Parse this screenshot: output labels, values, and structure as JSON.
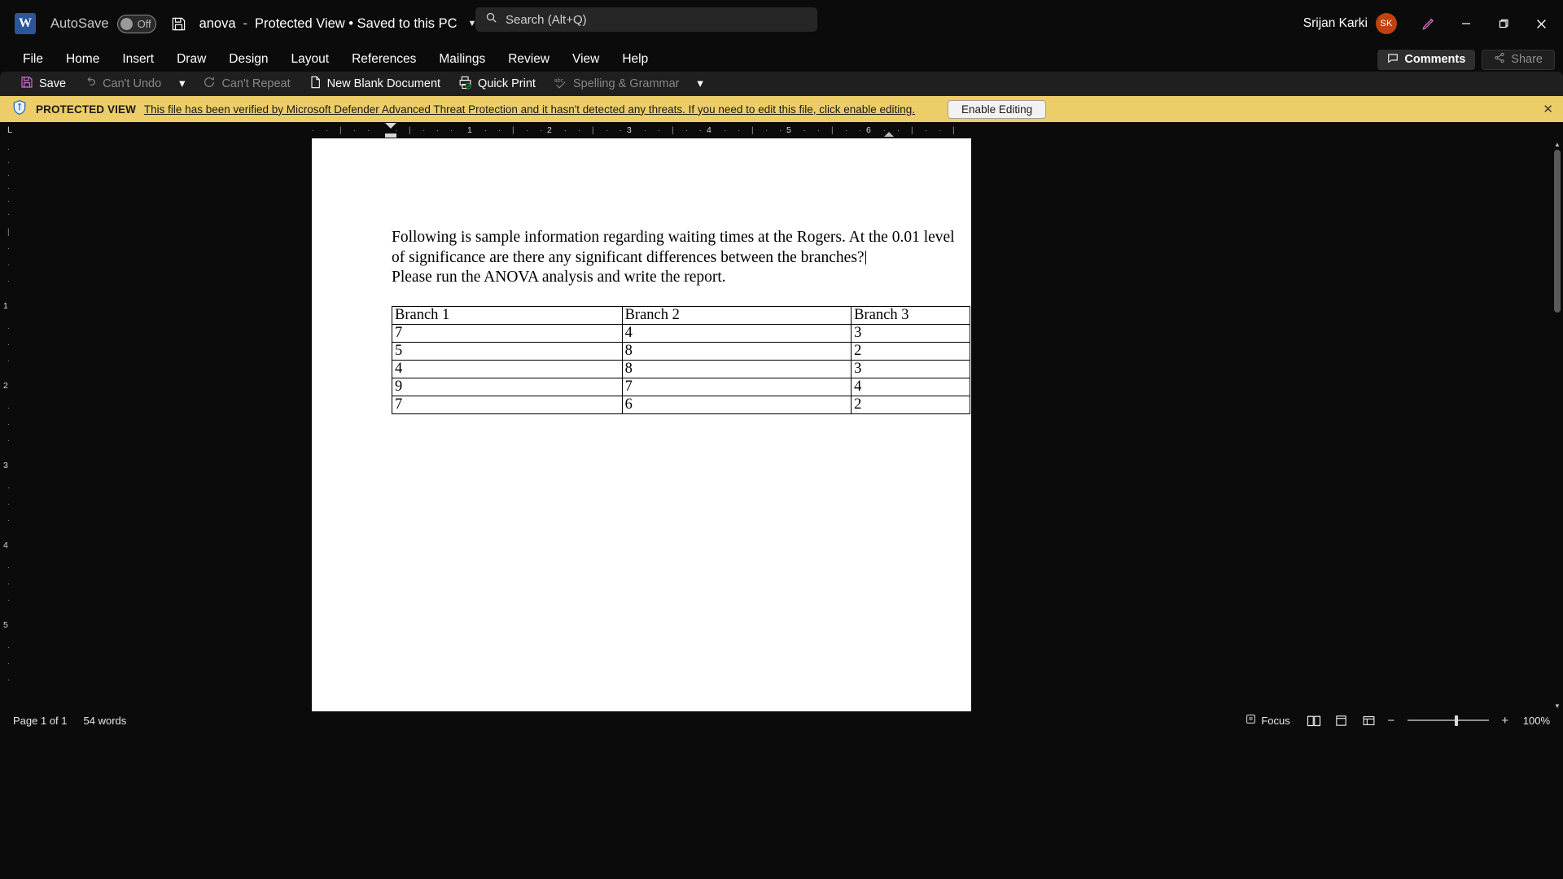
{
  "titlebar": {
    "logo_text": "W",
    "autosave_label": "AutoSave",
    "autosave_state": "Off",
    "save_icon": "floppy-disk-icon",
    "doc_name": "anova",
    "separator": "-",
    "doc_status": "Protected View • Saved to this PC",
    "dropdown_icon": "chevron-down-icon",
    "search_placeholder": "Search (Alt+Q)",
    "search_icon": "search-icon",
    "user_name": "Srijan Karki",
    "user_initials": "SK",
    "pen_icon": "ink-pen-icon",
    "minimize_icon": "minimize-icon",
    "restore_icon": "restore-icon",
    "close_icon": "close-icon"
  },
  "ribbon": {
    "tabs": [
      {
        "label": "File"
      },
      {
        "label": "Home"
      },
      {
        "label": "Insert"
      },
      {
        "label": "Draw"
      },
      {
        "label": "Design"
      },
      {
        "label": "Layout"
      },
      {
        "label": "References"
      },
      {
        "label": "Mailings"
      },
      {
        "label": "Review"
      },
      {
        "label": "View"
      },
      {
        "label": "Help"
      }
    ],
    "comments_label": "Comments",
    "comments_icon": "comment-icon",
    "share_label": "Share",
    "share_icon": "share-icon"
  },
  "quick_access": {
    "items": [
      {
        "label": "Save",
        "icon": "save-icon",
        "disabled": false
      },
      {
        "label": "Can't Undo",
        "icon": "undo-icon",
        "disabled": true
      },
      {
        "label": "Can't Repeat",
        "icon": "repeat-icon",
        "disabled": true
      },
      {
        "label": "New Blank Document",
        "icon": "new-document-icon",
        "disabled": false
      },
      {
        "label": "Quick Print",
        "icon": "printer-icon",
        "disabled": false
      },
      {
        "label": "Spelling & Grammar",
        "icon": "spellcheck-icon",
        "disabled": true
      }
    ],
    "overflow_icon": "chevron-down-icon"
  },
  "protected_view": {
    "info_icon": "info-shield-icon",
    "label": "PROTECTED VIEW",
    "message": "This file has been verified by Microsoft Defender Advanced Threat Protection and it hasn't detected any threats. If you need to edit this file, click enable editing.",
    "button_label": "Enable Editing",
    "close_icon": "close-icon",
    "background_color": "#edcd68"
  },
  "ruler": {
    "corner_label": "L",
    "horizontal_marks": [
      "1",
      "2",
      "3",
      "4",
      "5",
      "6"
    ],
    "vertical_marks": [
      "1",
      "2",
      "3",
      "4",
      "5"
    ]
  },
  "document": {
    "paragraphs": [
      "Following is sample information regarding waiting times at the Rogers. At the 0.01 level",
      "of significance are there any significant differences between the branches?",
      "Please run the ANOVA analysis and write the report."
    ],
    "table": {
      "headers": [
        "Branch 1",
        "Branch 2",
        "Branch 3"
      ],
      "rows": [
        [
          "7",
          "4",
          "3"
        ],
        [
          "5",
          "8",
          "2"
        ],
        [
          "4",
          "8",
          "3"
        ],
        [
          "9",
          "7",
          "4"
        ],
        [
          "7",
          "6",
          "2"
        ]
      ]
    }
  },
  "statusbar": {
    "page_info": "Page 1 of 1",
    "word_count": "54 words",
    "focus_label": "Focus",
    "focus_icon": "focus-icon",
    "view_read_icon": "read-mode-icon",
    "view_print_icon": "print-layout-icon",
    "view_web_icon": "web-layout-icon",
    "zoom_out_icon": "minus-icon",
    "zoom_in_icon": "plus-icon",
    "zoom_level": "100%"
  }
}
